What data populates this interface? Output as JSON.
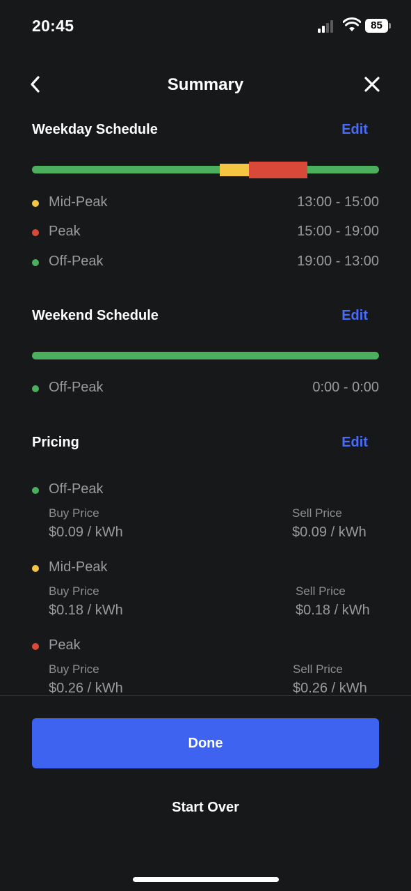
{
  "status_bar": {
    "time": "20:45",
    "battery": "85"
  },
  "nav": {
    "title": "Summary"
  },
  "colors": {
    "off_peak": "#4caf5d",
    "mid_peak": "#f4c542",
    "peak": "#d9493a",
    "accent": "#3e63f0",
    "edit": "#4a6cf7"
  },
  "weekday": {
    "title": "Weekday Schedule",
    "edit_label": "Edit",
    "legend": [
      {
        "label": "Mid-Peak",
        "time": "13:00 - 15:00",
        "color": "#f4c542"
      },
      {
        "label": "Peak",
        "time": "15:00 - 19:00",
        "color": "#d9493a"
      },
      {
        "label": "Off-Peak",
        "time": "19:00 - 13:00",
        "color": "#4caf5d"
      }
    ]
  },
  "weekend": {
    "title": "Weekend Schedule",
    "edit_label": "Edit",
    "legend": [
      {
        "label": "Off-Peak",
        "time": "0:00 - 0:00",
        "color": "#4caf5d"
      }
    ]
  },
  "pricing": {
    "title": "Pricing",
    "edit_label": "Edit",
    "buy_label": "Buy Price",
    "sell_label": "Sell Price",
    "tiers": [
      {
        "name": "Off-Peak",
        "buy": "$0.09 / kWh",
        "sell": "$0.09 / kWh",
        "color": "#4caf5d"
      },
      {
        "name": "Mid-Peak",
        "buy": "$0.18 / kWh",
        "sell": "$0.18 / kWh",
        "color": "#f4c542"
      },
      {
        "name": "Peak",
        "buy": "$0.26 / kWh",
        "sell": "$0.26 / kWh",
        "color": "#d9493a"
      }
    ]
  },
  "actions": {
    "done_label": "Done",
    "start_over_label": "Start Over"
  }
}
